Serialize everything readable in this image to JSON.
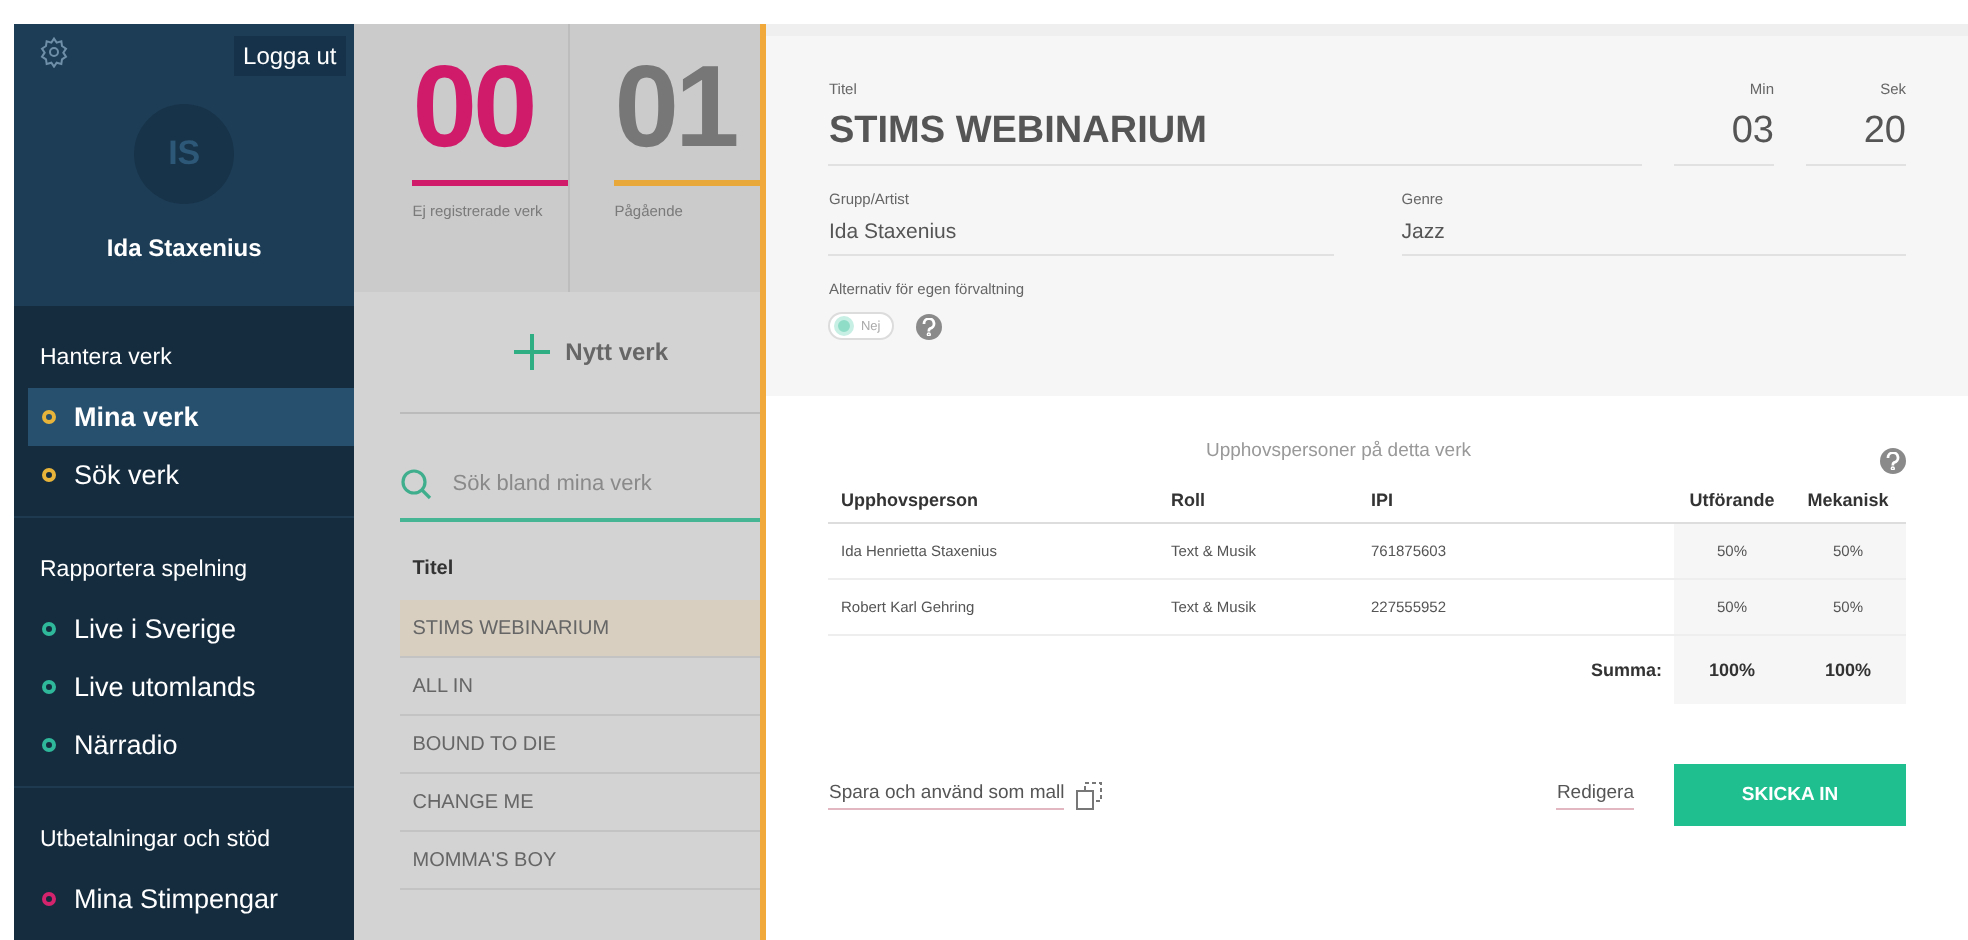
{
  "sidebar": {
    "logout_button": "Logga ut",
    "avatar_initials": "IS",
    "user_name": "Ida Staxenius",
    "sections": [
      {
        "title": "Hantera verk",
        "items": [
          {
            "label": "Mina verk",
            "selected": true,
            "color": "#e8b53a"
          },
          {
            "label": "Sök verk",
            "selected": false,
            "color": "#e8b53a"
          }
        ]
      },
      {
        "title": "Rapportera spelning",
        "items": [
          {
            "label": "Live i Sverige",
            "selected": false,
            "color": "#2fb89a"
          },
          {
            "label": "Live utomlands",
            "selected": false,
            "color": "#2fb89a"
          },
          {
            "label": "Närradio",
            "selected": false,
            "color": "#2fb89a"
          }
        ]
      },
      {
        "title": "Utbetalningar och stöd",
        "items": [
          {
            "label": "Mina Stimpengar",
            "selected": false,
            "color": "#d4246e"
          }
        ]
      }
    ]
  },
  "stats": [
    {
      "value": "00",
      "label": "Ej registrerade verk",
      "color": "#d01a6a"
    },
    {
      "value": "01",
      "label": "Pågående",
      "color": "#e8a93a"
    }
  ],
  "new_work_button": "Nytt verk",
  "search": {
    "placeholder": "Sök bland mina verk"
  },
  "works_table": {
    "column": "Titel",
    "rows": [
      {
        "title": "STIMS WEBINARIUM",
        "selected": true
      },
      {
        "title": "ALL IN",
        "selected": false
      },
      {
        "title": "BOUND TO DIE",
        "selected": false
      },
      {
        "title": "CHANGE ME",
        "selected": false
      },
      {
        "title": "MOMMA'S BOY",
        "selected": false
      }
    ]
  },
  "form": {
    "title_label": "Titel",
    "title_value": "STIMS WEBINARIUM",
    "min_label": "Min",
    "min_value": "03",
    "sec_label": "Sek",
    "sec_value": "20",
    "artist_label": "Grupp/Artist",
    "artist_value": "Ida Staxenius",
    "genre_label": "Genre",
    "genre_value": "Jazz",
    "self_admin_label": "Alternativ för egen förvaltning",
    "self_admin_toggle": {
      "on": false,
      "label": "Nej"
    }
  },
  "creators": {
    "heading": "Upphovspersoner på detta verk",
    "columns": [
      "Upphovsperson",
      "Roll",
      "IPI",
      "Utförande",
      "Mekanisk"
    ],
    "rows": [
      [
        "Ida Henrietta Staxenius",
        "Text & Musik",
        "761875603",
        "50%",
        "50%"
      ],
      [
        "Robert Karl Gehring",
        "Text & Musik",
        "227555952",
        "50%",
        "50%"
      ]
    ],
    "sum_label": "Summa:",
    "sum_values": [
      "100%",
      "100%"
    ]
  },
  "actions": {
    "save_template_link": "Spara och använd som mall",
    "edit_link": "Redigera",
    "submit_button": "SKICKA IN"
  }
}
